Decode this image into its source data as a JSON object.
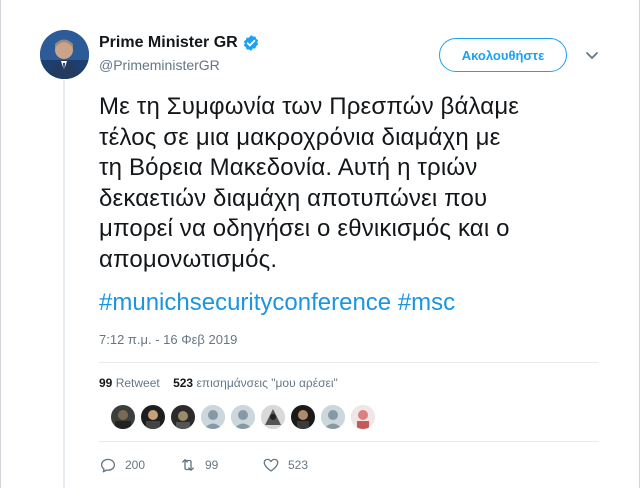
{
  "account": {
    "display_name": "Prime Minister GR",
    "handle": "@PrimeministerGR",
    "verified": true
  },
  "header": {
    "follow_label": "Ακολουθήστε"
  },
  "tweet": {
    "lines": [
      "Με τη Συμφωνία των Πρεσπών βάλαμε",
      "τέλος σε μια μακροχρόνια διαμάχη με",
      "τη Βόρεια Μακεδονία. Αυτή η τριών",
      "δεκαετιών διαμάχη αποτυπώνει που",
      "μπορεί να οδηγήσει ο εθνικισμός και ο",
      "απομονωτισμός."
    ],
    "hashtags": [
      "#munichsecurityconference",
      "#msc"
    ],
    "timestamp": "7:12 π.μ. - 16 Φεβ 2019"
  },
  "stats": {
    "retweet_count": "99",
    "retweet_label": "Retweet",
    "like_count": "523",
    "like_label": "επισημάνσεις \"μου αρέσει\""
  },
  "likers": [
    {
      "icon": "liker-avatar-1"
    },
    {
      "icon": "liker-avatar-2"
    },
    {
      "icon": "liker-avatar-3"
    },
    {
      "icon": "liker-avatar-4"
    },
    {
      "icon": "liker-avatar-5"
    },
    {
      "icon": "liker-avatar-6"
    },
    {
      "icon": "liker-avatar-7"
    },
    {
      "icon": "liker-avatar-8"
    },
    {
      "icon": "liker-avatar-9"
    }
  ],
  "actions": {
    "reply_count": "200",
    "retweet_count": "99",
    "like_count": "523"
  },
  "colors": {
    "accent": "#1da1f2",
    "hashtag": "#1b95e0",
    "muted": "#657786",
    "text": "#14171a"
  }
}
